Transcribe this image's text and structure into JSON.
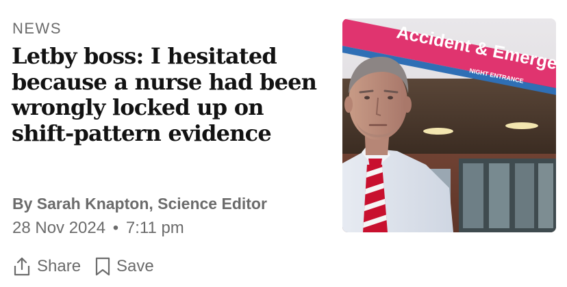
{
  "article": {
    "section": "NEWS",
    "headline": "Letby boss: I hesitated because a nurse had been wrongly locked up on shift-pattern evidence",
    "byline": "By Sarah Knapton, Science Editor",
    "date": "28 Nov 2024",
    "separator": "•",
    "time": "7:11 pm"
  },
  "actions": {
    "share_label": "Share",
    "save_label": "Save"
  },
  "image": {
    "sign_text": "Accident & Emerge",
    "sign_subtext": "NIGHT ENTRANCE",
    "colors": {
      "sign_pink": "#e0346f",
      "sign_blue": "#2f6fb5",
      "tie_red": "#c8102e"
    }
  },
  "colors": {
    "text_primary": "#121212",
    "text_secondary": "#6b6b6b"
  }
}
